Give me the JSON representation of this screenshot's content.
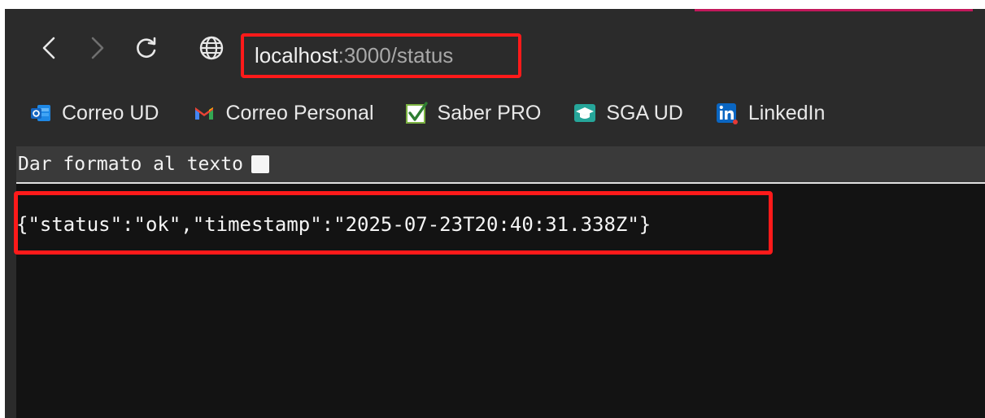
{
  "address_bar": {
    "host": "localhost",
    "rest": ":3000/status"
  },
  "bookmarks": [
    {
      "label": "Correo UD",
      "icon": "outlook-icon"
    },
    {
      "label": "Correo Personal",
      "icon": "gmail-icon"
    },
    {
      "label": "Saber PRO",
      "icon": "checkmark-box-icon"
    },
    {
      "label": "SGA UD",
      "icon": "graduation-cap-icon"
    },
    {
      "label": "LinkedIn",
      "icon": "linkedin-icon"
    }
  ],
  "pretty_print": {
    "label": "Dar formato al texto"
  },
  "content": {
    "json": "{\"status\":\"ok\",\"timestamp\":\"2025-07-23T20:40:31.338Z\"}"
  },
  "colors": {
    "highlight": "#ff1a1a",
    "accent": "#c2185b"
  }
}
